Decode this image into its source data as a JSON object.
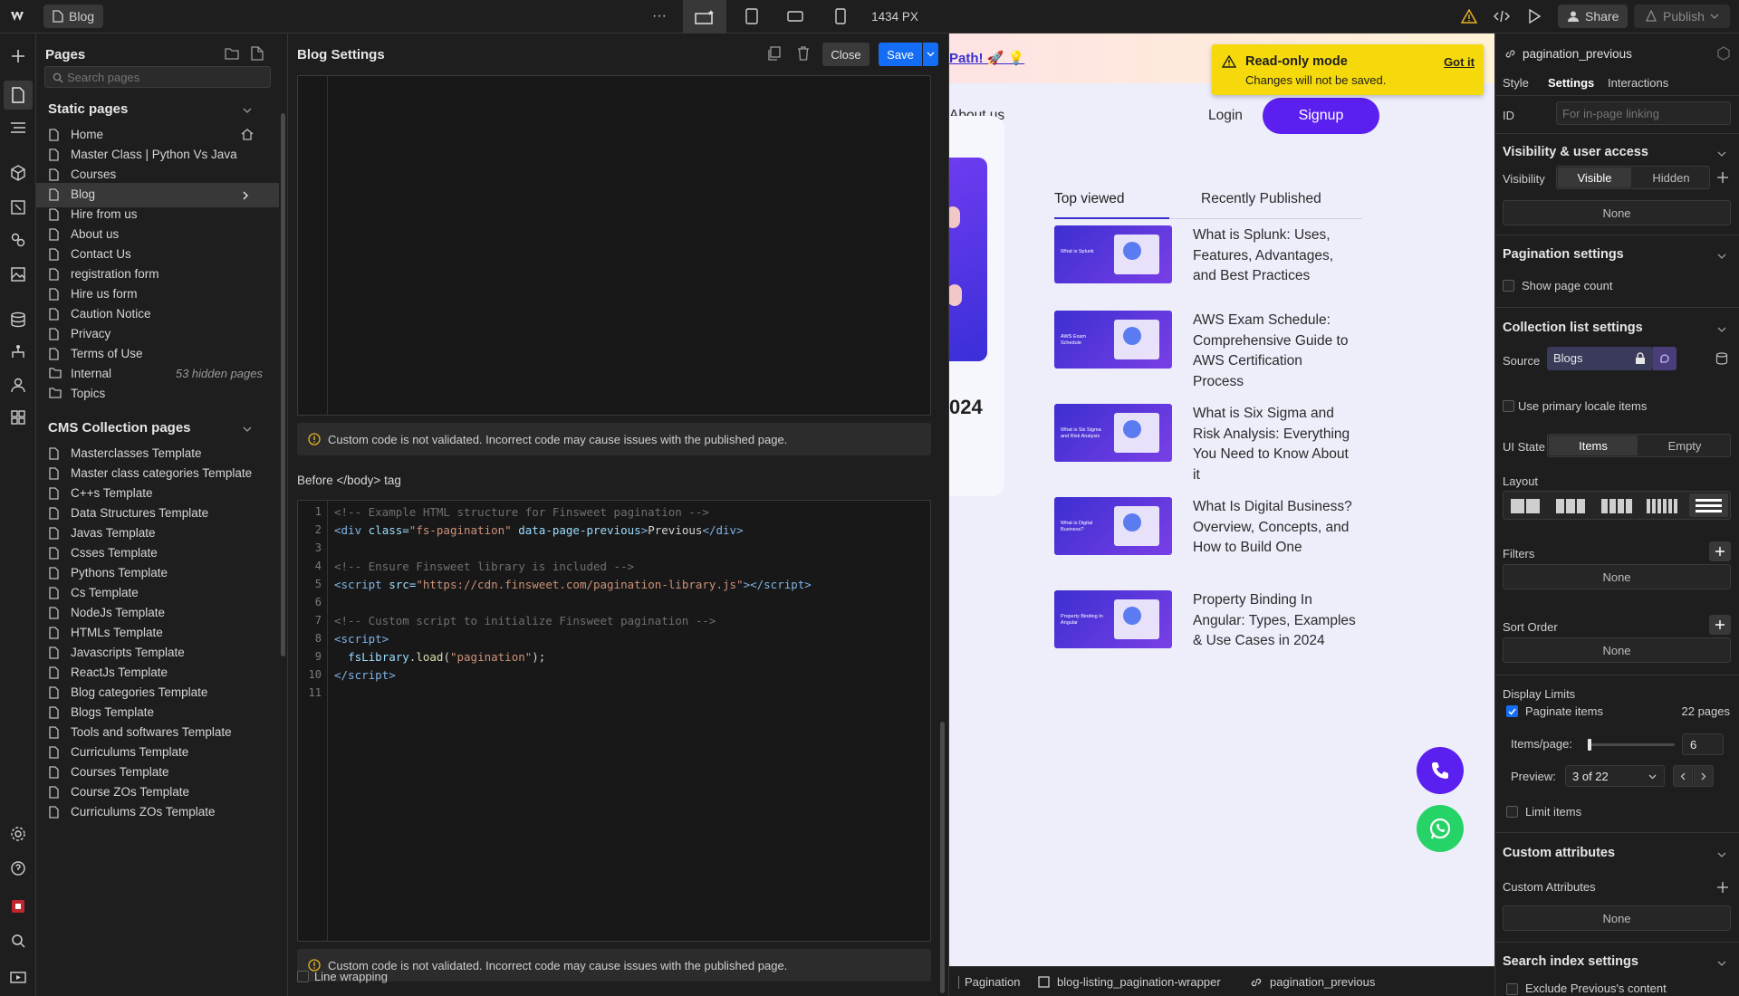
{
  "topbar": {
    "page_name": "Blog",
    "more": "···",
    "width_label": "1434 PX",
    "share": "Share",
    "publish": "Publish"
  },
  "pages_panel": {
    "title": "Pages",
    "search_placeholder": "Search pages",
    "static_heading": "Static pages",
    "static_pages": [
      "Home",
      "Master Class | Python Vs Java",
      "Courses",
      "Blog",
      "Hire from us",
      "About us",
      "Contact Us",
      "registration form",
      "Hire us form",
      "Caution Notice",
      "Privacy",
      "Terms of Use"
    ],
    "folders": [
      {
        "label": "Internal",
        "note": "53 hidden pages"
      },
      {
        "label": "Topics",
        "note": ""
      }
    ],
    "cms_heading": "CMS Collection pages",
    "cms_pages": [
      "Masterclasses Template",
      "Master class categories Template",
      "C++s Template",
      "Data Structures Template",
      "Javas Template",
      "Csses Template",
      "Pythons Template",
      "Cs Template",
      "NodeJs Template",
      "HTMLs Template",
      "Javascripts Template",
      "ReactJs Template",
      "Blog categories Template",
      "Blogs Template",
      "Tools and softwares Template",
      "Curriculums Template",
      "Courses Template",
      "Course ZOs Template",
      "Curriculums ZOs Template"
    ]
  },
  "settings_panel": {
    "title": "Blog Settings",
    "close": "Close",
    "save": "Save",
    "warning": "Custom code is not validated. Incorrect code may cause issues with the published page.",
    "before_body_label": "Before </body> tag",
    "line_numbers": [
      "1",
      "2",
      "3",
      "4",
      "5",
      "6",
      "7",
      "8",
      "9",
      "10",
      "11"
    ],
    "line_wrapping": "Line wrapping"
  },
  "canvas": {
    "banner_link": "Path! 🚀 💡",
    "nav_about": "About us",
    "login": "Login",
    "signup": "Signup",
    "year_fragment": "024",
    "tabs": [
      "Top viewed",
      "Recently Published"
    ],
    "posts": [
      {
        "thumb": "What is Splunk",
        "title": "What is Splunk: Uses, Features, Advantages, and Best Practices"
      },
      {
        "thumb": "AWS Exam Schedule",
        "title": "AWS Exam Schedule: Comprehensive Guide to AWS Certification Process"
      },
      {
        "thumb": "What is Six Sigma and Risk Analysis",
        "title": "What is Six Sigma and Risk Analysis: Everything You Need to Know About it"
      },
      {
        "thumb": "What is Digital Business?",
        "title": "What Is Digital Business? Overview, Concepts, and How to Build One"
      },
      {
        "thumb": "Property Binding In Angular",
        "title": "Property Binding In Angular: Types, Examples & Use Cases in 2024"
      }
    ],
    "toast_title": "Read-only mode",
    "toast_body": "Changes will not be saved.",
    "toast_action": "Got it"
  },
  "breadcrumbs": [
    "Pagination",
    "blog-listing_pagination-wrapper",
    "pagination_previous"
  ],
  "right_panel": {
    "element": "pagination_previous",
    "tabs": [
      "Style",
      "Settings",
      "Interactions"
    ],
    "id_label": "ID",
    "id_placeholder": "For in-page linking",
    "visibility_heading": "Visibility & user access",
    "visibility_label": "Visibility",
    "visible": "Visible",
    "hidden": "Hidden",
    "none": "None",
    "pagination_heading": "Pagination settings",
    "show_page_count": "Show page count",
    "collection_heading": "Collection list settings",
    "source_label": "Source",
    "source_value": "Blogs",
    "primary_locale": "Use primary locale items",
    "ui_state_label": "UI State",
    "items": "Items",
    "empty": "Empty",
    "layout_label": "Layout",
    "filters_label": "Filters",
    "sort_label": "Sort Order",
    "display_limits": "Display Limits",
    "paginate_items": "Paginate items",
    "pages_count": "22 pages",
    "items_per_page_label": "Items/page:",
    "items_per_page": "6",
    "preview_label": "Preview:",
    "preview_value": "3 of 22",
    "limit_items": "Limit items",
    "custom_attr_heading": "Custom attributes",
    "custom_attr_label": "Custom Attributes",
    "search_index_heading": "Search index settings",
    "exclude_label": "Exclude Previous's content"
  }
}
